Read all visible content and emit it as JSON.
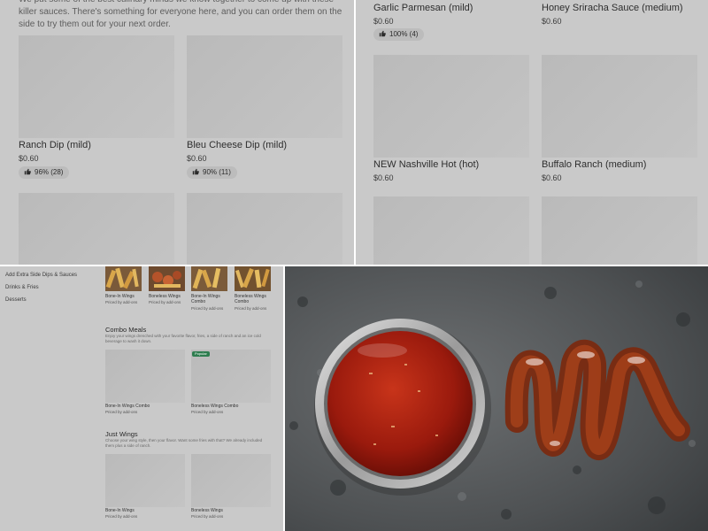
{
  "top_left": {
    "intro_text": "We put some of the best culinary minds we know together to come up with these killer sauces. There's something for everyone here, and you can order them on the side to try them out for your next order.",
    "items": [
      {
        "name": "Ranch Dip (mild)",
        "price": "$0.60",
        "rating": "96% (28)"
      },
      {
        "name": "Bleu Cheese Dip (mild)",
        "price": "$0.60",
        "rating": "90% (11)"
      }
    ]
  },
  "top_right": {
    "items": [
      {
        "name": "Garlic Parmesan (mild)",
        "price": "$0.60",
        "rating": "100% (4)"
      },
      {
        "name": "Honey Sriracha Sauce (medium)",
        "price": "$0.60"
      },
      {
        "name": "NEW Nashville Hot (hot)",
        "price": "$0.60"
      },
      {
        "name": "Buffalo Ranch (medium)",
        "price": "$0.60"
      }
    ]
  },
  "bottom_left": {
    "sidebar": [
      "Add Extra Side Dips & Sauces",
      "Drinks & Fries",
      "Desserts"
    ],
    "top_row": [
      {
        "name": "Bone-In Wings",
        "sub": "Priced by add-ons"
      },
      {
        "name": "Boneless Wings",
        "sub": "Priced by add-ons"
      },
      {
        "name": "Bone-In Wings Combo",
        "sub": "Priced by add-ons"
      },
      {
        "name": "Boneless Wings Combo",
        "sub": "Priced by add-ons"
      }
    ],
    "combo_title": "Combo Meals",
    "combo_desc": "Enjoy your wings drenched with your favorite flavor, fries, a side of ranch and an ice cold beverage to wash it down.",
    "combo_items": [
      {
        "name": "Bone-In Wings Combo",
        "sub": "Priced by add-ons"
      },
      {
        "name": "Boneless Wings Combo",
        "sub": "Priced by add-ons",
        "badge": "Popular"
      }
    ],
    "wings_title": "Just Wings",
    "wings_desc": "Choose your wing style, then your flavor. Want some fries with that? We already included them plus a side of ranch.",
    "wings_items": [
      {
        "name": "Bone-In Wings",
        "sub": "Priced by add-ons"
      },
      {
        "name": "Boneless Wings",
        "sub": "Priced by add-ons"
      }
    ]
  },
  "colors": {
    "panel_overlay": "#c9c9c9",
    "tile": "#bdbdbd",
    "popular_badge": "#2e7d4f",
    "sauce": "#9a1a0d",
    "stone": "#4a4d4f"
  },
  "icons": {
    "rating": "thumbs-up-icon"
  }
}
